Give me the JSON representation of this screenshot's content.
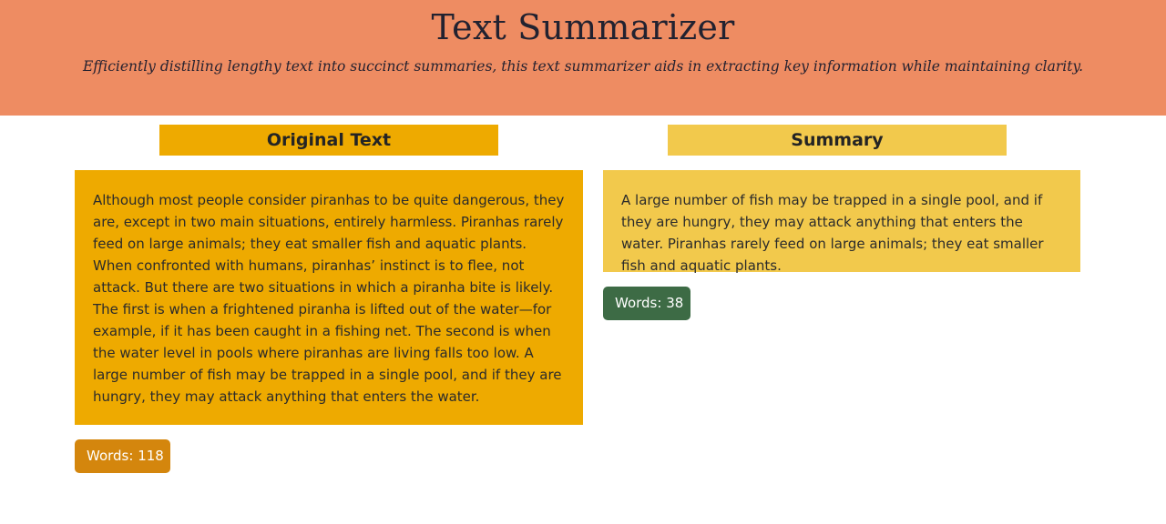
{
  "header": {
    "title": "Text Summarizer",
    "subtitle": "Efficiently distilling lengthy text into succinct summaries, this text summarizer aids in extracting key information while maintaining clarity."
  },
  "original": {
    "heading": "Original Text",
    "text": "Although most people consider piranhas to be quite dangerous, they are, except in two main situations, entirely harmless. Piranhas rarely feed on large animals; they eat smaller fish and aquatic plants. When confronted with humans, piranhas’ instinct is to flee, not attack. But there are two situations in which a piranha bite is likely. The first is when a frightened piranha is lifted out of the water—for example, if it has been caught in a fishing net. The second is when the water level in pools where piranhas are living falls too low. A large number of fish may be trapped in a single pool, and if they are hungry, they may attack anything that enters the water.",
    "word_count_label": "Words: 118"
  },
  "summary": {
    "heading": "Summary",
    "text": "A large number of fish may be trapped in a single pool, and if they are hungry, they may attack anything that enters the water. Piranhas rarely feed on large animals; they eat smaller fish and aquatic plants.",
    "word_count_label": "Words: 38"
  },
  "colors": {
    "header_bg": "#ee8c62",
    "original_bg": "#eeaa00",
    "summary_bg": "#f2c94c",
    "original_badge": "#d4860d",
    "summary_badge": "#3d6b45"
  }
}
